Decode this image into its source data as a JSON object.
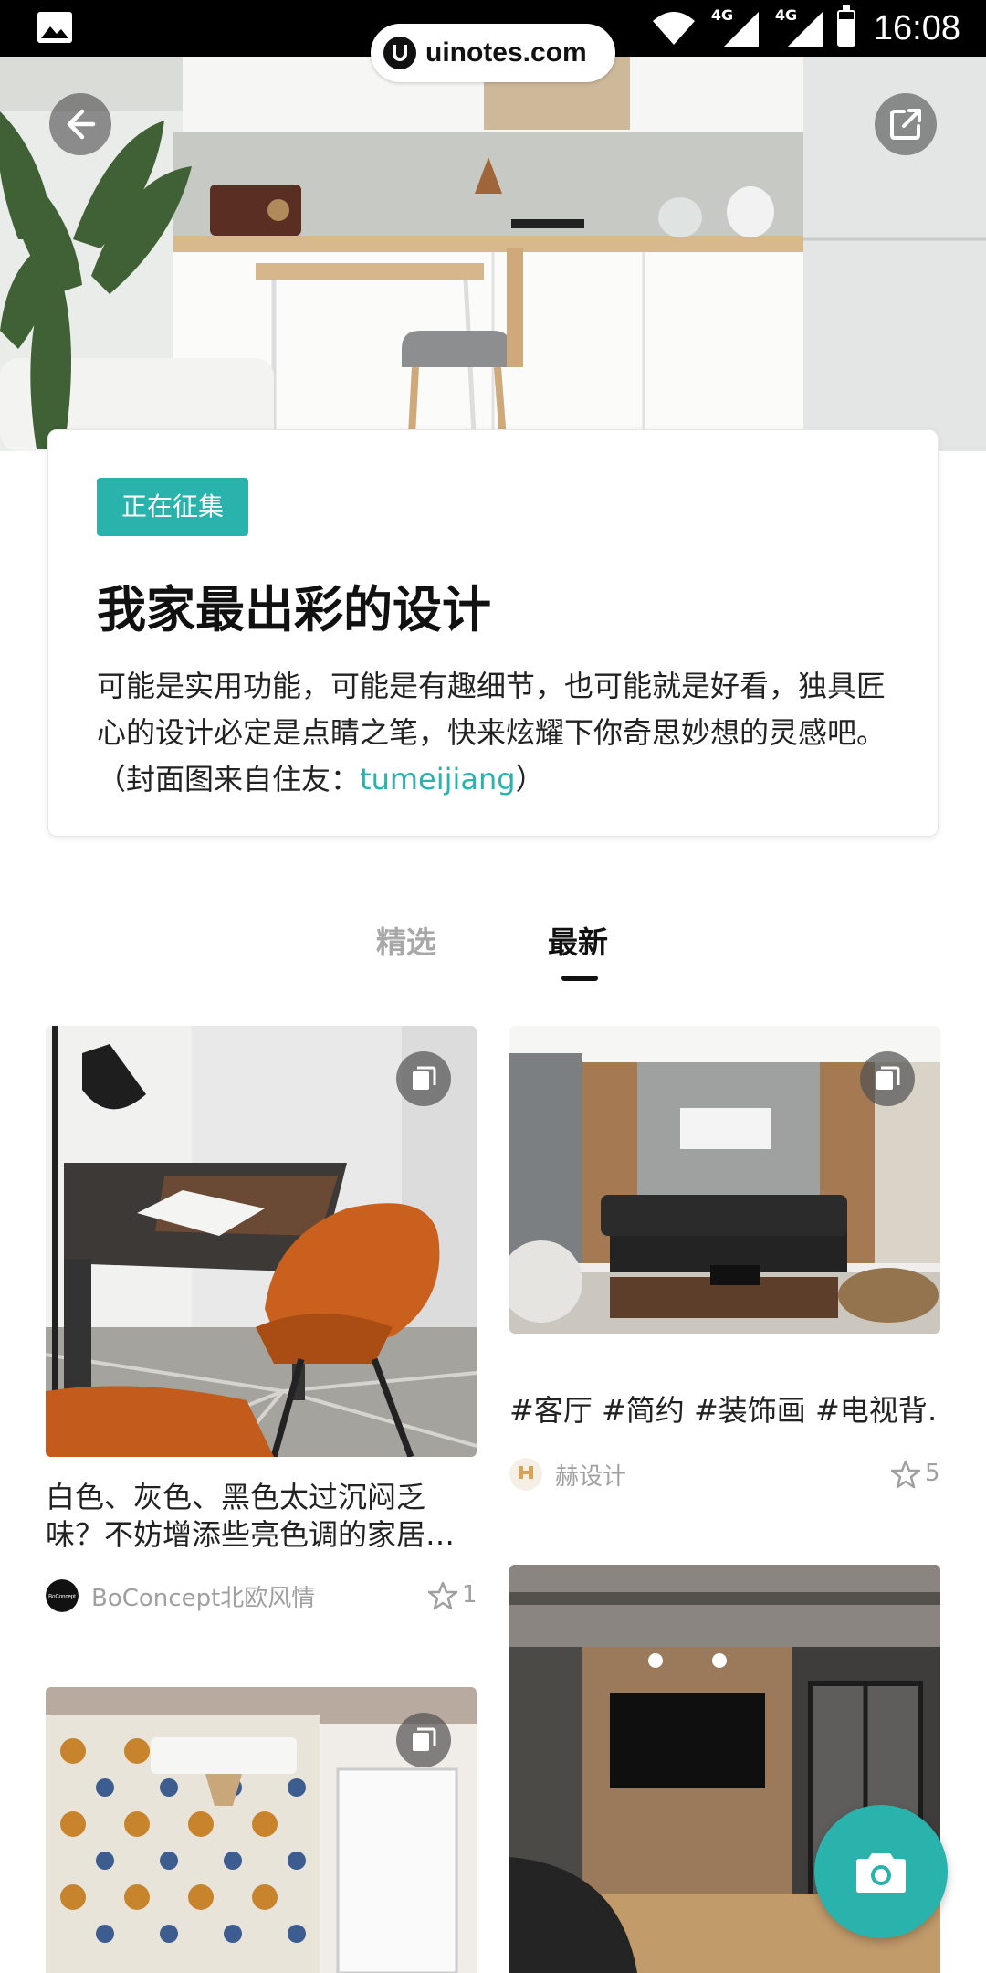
{
  "status_bar": {
    "time": "16:08",
    "network_1": "4G",
    "network_2": "4G",
    "battery_level": 0.78
  },
  "watermark": {
    "text": "uinotes.com"
  },
  "header": {
    "back_icon": "arrow-left-icon",
    "share_icon": "share-external-icon"
  },
  "topic": {
    "status_badge": "正在征集",
    "title": "我家最出彩的设计",
    "description_before_link": "可能是实用功能，可能是有趣细节，也可能就是好看，独具匠心的设计必定是点睛之笔，快来炫耀下你奇思妙想的灵感吧。（封面图来自住友：",
    "description_link": "tumeijiang",
    "description_after_link": "）"
  },
  "tabs": [
    {
      "label": "精选",
      "active": false
    },
    {
      "label": "最新",
      "active": true
    }
  ],
  "posts": [
    {
      "title": "白色、灰色、黑色太过沉闷乏味？不妨增添些亮色调的家居…",
      "author": "BoConcept北欧风情",
      "avatar_text": "BoConcept",
      "stars": "1",
      "multi_image": true
    },
    {
      "title": "#客厅 #简约 #装饰画 #电视背…",
      "author": "赫设计",
      "stars": "5",
      "multi_image": true
    },
    {
      "multi_image": true
    },
    {
      "multi_image": false
    }
  ],
  "fab": {
    "icon": "camera-icon"
  },
  "colors": {
    "accent": "#2ab3ad",
    "status_bar": "#000000"
  }
}
